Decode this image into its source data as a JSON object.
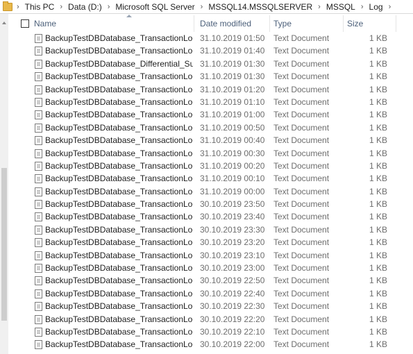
{
  "breadcrumb": [
    "This PC",
    "Data (D:)",
    "Microsoft SQL Server",
    "MSSQL14.MSSQLSERVER",
    "MSSQL",
    "Log"
  ],
  "columns": {
    "name": "Name",
    "date": "Date modified",
    "type": "Type",
    "size": "Size"
  },
  "files": [
    {
      "name": "BackupTestDBDatabase_TransactionLog_Su...",
      "date": "31.10.2019 01:50",
      "type": "Text Document",
      "size": "1 KB"
    },
    {
      "name": "BackupTestDBDatabase_TransactionLog_Su...",
      "date": "31.10.2019 01:40",
      "type": "Text Document",
      "size": "1 KB"
    },
    {
      "name": "BackupTestDBDatabase_Differential_Subpla...",
      "date": "31.10.2019 01:30",
      "type": "Text Document",
      "size": "1 KB"
    },
    {
      "name": "BackupTestDBDatabase_TransactionLog_Su...",
      "date": "31.10.2019 01:30",
      "type": "Text Document",
      "size": "1 KB"
    },
    {
      "name": "BackupTestDBDatabase_TransactionLog_Su...",
      "date": "31.10.2019 01:20",
      "type": "Text Document",
      "size": "1 KB"
    },
    {
      "name": "BackupTestDBDatabase_TransactionLog_Su...",
      "date": "31.10.2019 01:10",
      "type": "Text Document",
      "size": "1 KB"
    },
    {
      "name": "BackupTestDBDatabase_TransactionLog_Su...",
      "date": "31.10.2019 01:00",
      "type": "Text Document",
      "size": "1 KB"
    },
    {
      "name": "BackupTestDBDatabase_TransactionLog_Su...",
      "date": "31.10.2019 00:50",
      "type": "Text Document",
      "size": "1 KB"
    },
    {
      "name": "BackupTestDBDatabase_TransactionLog_Su...",
      "date": "31.10.2019 00:40",
      "type": "Text Document",
      "size": "1 KB"
    },
    {
      "name": "BackupTestDBDatabase_TransactionLog_Su...",
      "date": "31.10.2019 00:30",
      "type": "Text Document",
      "size": "1 KB"
    },
    {
      "name": "BackupTestDBDatabase_TransactionLog_Su...",
      "date": "31.10.2019 00:20",
      "type": "Text Document",
      "size": "1 KB"
    },
    {
      "name": "BackupTestDBDatabase_TransactionLog_Su...",
      "date": "31.10.2019 00:10",
      "type": "Text Document",
      "size": "1 KB"
    },
    {
      "name": "BackupTestDBDatabase_TransactionLog_Su...",
      "date": "31.10.2019 00:00",
      "type": "Text Document",
      "size": "1 KB"
    },
    {
      "name": "BackupTestDBDatabase_TransactionLog_Su...",
      "date": "30.10.2019 23:50",
      "type": "Text Document",
      "size": "1 KB"
    },
    {
      "name": "BackupTestDBDatabase_TransactionLog_Su...",
      "date": "30.10.2019 23:40",
      "type": "Text Document",
      "size": "1 KB"
    },
    {
      "name": "BackupTestDBDatabase_TransactionLog_Su...",
      "date": "30.10.2019 23:30",
      "type": "Text Document",
      "size": "1 KB"
    },
    {
      "name": "BackupTestDBDatabase_TransactionLog_Su...",
      "date": "30.10.2019 23:20",
      "type": "Text Document",
      "size": "1 KB"
    },
    {
      "name": "BackupTestDBDatabase_TransactionLog_Su...",
      "date": "30.10.2019 23:10",
      "type": "Text Document",
      "size": "1 KB"
    },
    {
      "name": "BackupTestDBDatabase_TransactionLog_Su...",
      "date": "30.10.2019 23:00",
      "type": "Text Document",
      "size": "1 KB"
    },
    {
      "name": "BackupTestDBDatabase_TransactionLog_Su...",
      "date": "30.10.2019 22:50",
      "type": "Text Document",
      "size": "1 KB"
    },
    {
      "name": "BackupTestDBDatabase_TransactionLog_Su...",
      "date": "30.10.2019 22:40",
      "type": "Text Document",
      "size": "1 KB"
    },
    {
      "name": "BackupTestDBDatabase_TransactionLog_Su...",
      "date": "30.10.2019 22:30",
      "type": "Text Document",
      "size": "1 KB"
    },
    {
      "name": "BackupTestDBDatabase_TransactionLog_Su...",
      "date": "30.10.2019 22:20",
      "type": "Text Document",
      "size": "1 KB"
    },
    {
      "name": "BackupTestDBDatabase_TransactionLog_Su...",
      "date": "30.10.2019 22:10",
      "type": "Text Document",
      "size": "1 KB"
    },
    {
      "name": "BackupTestDBDatabase_TransactionLog_Su...",
      "date": "30.10.2019 22:00",
      "type": "Text Document",
      "size": "1 KB"
    }
  ]
}
